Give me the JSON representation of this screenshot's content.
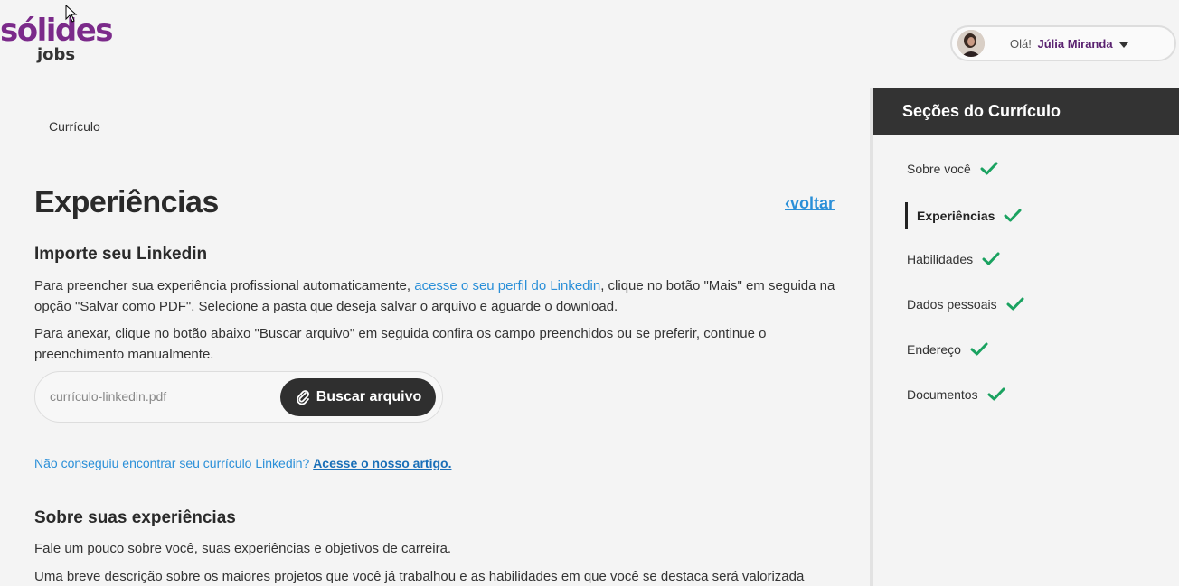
{
  "logo": {
    "main": "sólides",
    "sub": "jobs"
  },
  "user": {
    "greeting": "Olá!",
    "name": "Júlia Miranda"
  },
  "breadcrumb": "Currículo",
  "page": {
    "title": "Experiências",
    "back_label": "‹voltar"
  },
  "linkedin": {
    "heading": "Importe seu Linkedin",
    "para1_before": "Para preencher sua experiência profissional automaticamente, ",
    "para1_link": "acesse o seu perfil do Linkedin",
    "para1_after": ", clique no botão \"Mais\" em seguida na opção \"Salvar como PDF\". Selecione a pasta que deseja salvar o arquivo e aguarde o download.",
    "para2": "Para anexar, clique no botão abaixo \"Buscar arquivo\" em seguida confira os campo preenchidos ou se preferir, continue o preenchimento manualmente.",
    "file_placeholder": "currículo-linkedin.pdf",
    "upload_button": "Buscar arquivo",
    "help_text": "Não conseguiu encontrar seu currículo Linkedin? ",
    "help_link": "Acesse o nosso artigo."
  },
  "about": {
    "heading": "Sobre suas experiências",
    "para1": "Fale um pouco sobre você, suas experiências e objetivos de carreira.",
    "para2": "Uma breve descrição sobre os maiores projetos que você já trabalhou e as habilidades em que você se destaca será valorizada pelos"
  },
  "sidebar": {
    "title": "Seções do Currículo",
    "check_color": "#1aa260",
    "items": [
      {
        "label": "Sobre você",
        "done": true
      },
      {
        "label": "Experiências",
        "done": true,
        "active": true
      },
      {
        "label": "Habilidades",
        "done": true
      },
      {
        "label": "Dados pessoais",
        "done": true
      },
      {
        "label": "Endereço",
        "done": true
      },
      {
        "label": "Documentos",
        "done": true
      }
    ]
  }
}
